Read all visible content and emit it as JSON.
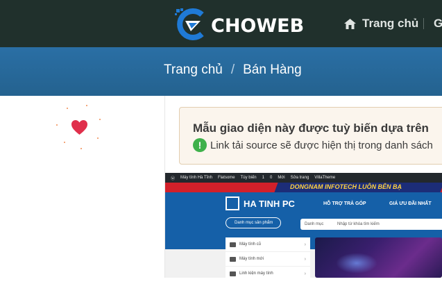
{
  "header": {
    "logo_text": "CHOWEB",
    "nav": [
      {
        "label": "Trang chủ",
        "icon": "home-icon"
      },
      {
        "label": "G"
      }
    ]
  },
  "breadcrumb": {
    "items": [
      "Trang chủ",
      "Bán Hàng"
    ],
    "separator": "/"
  },
  "notice": {
    "title": "Mẫu giao diện này được tuỳ biến dựa trên",
    "text": "Link tải source sẽ được hiện thị trong danh sách",
    "icon": "exclamation-icon"
  },
  "preview": {
    "admin_bar": [
      "Máy tính Hà Tĩnh",
      "Flatsome",
      "Tùy biến",
      "1",
      "0",
      "Mới",
      "Sửa trang",
      "VillaTheme"
    ],
    "promo_text": "DONGNAM INFOTECH  LUÔN BÊN BẠ",
    "shop_name": "HA TINH PC",
    "links": [
      "HỖ TRỢ TRẢ GÓP",
      "GIÁ ƯU ĐÃI NHẤT"
    ],
    "category_button": "Danh mục sản phẩm",
    "search_category": "Danh mục",
    "search_placeholder": "Nhập từ khóa tìm kiếm",
    "menu": [
      "Máy tính cũ",
      "Máy tính mới",
      "Linh kiện máy tính"
    ]
  },
  "colors": {
    "topbar": "#20302c",
    "breadcrumb_bar": "#2a6fa5",
    "logo_accent": "#1f7ad6",
    "heart": "#e02f4b",
    "notice_bg": "#fbf5ed",
    "notice_icon": "#3fb14b"
  }
}
